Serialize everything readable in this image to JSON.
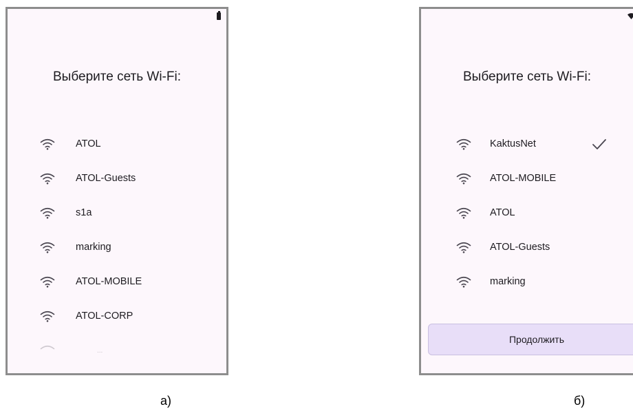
{
  "screen_a": {
    "title": "Выберите сеть Wi-Fi:",
    "networks": [
      {
        "name": "ATOL"
      },
      {
        "name": "ATOL-Guests"
      },
      {
        "name": "s1a"
      },
      {
        "name": "marking"
      },
      {
        "name": "ATOL-MOBILE"
      },
      {
        "name": "ATOL-CORP"
      },
      {
        "name": "..."
      }
    ],
    "status_icons": [
      "battery-icon"
    ]
  },
  "screen_b": {
    "title": "Выберите сеть Wi-Fi:",
    "networks": [
      {
        "name": "KaktusNet",
        "selected": true
      },
      {
        "name": "ATOL-MOBILE"
      },
      {
        "name": "ATOL"
      },
      {
        "name": "ATOL-Guests"
      },
      {
        "name": "marking"
      }
    ],
    "continue_label": "Продолжить",
    "status_icons": [
      "wifi-status-icon",
      "battery-icon"
    ]
  },
  "captions": {
    "a": "а)",
    "b": "б)"
  },
  "colors": {
    "screen_bg": "#fdf7fc",
    "border": "#8d8d8d",
    "button_bg": "#e8def8",
    "text": "#1d1b20"
  }
}
